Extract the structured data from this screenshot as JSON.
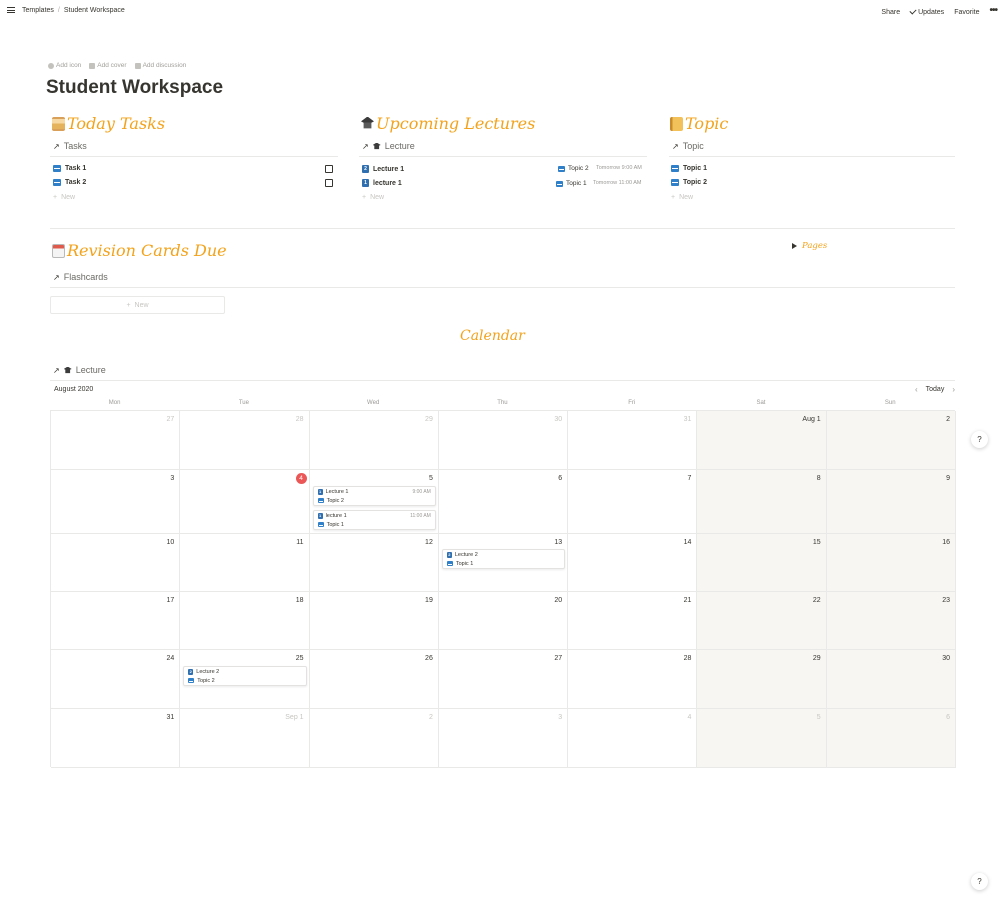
{
  "topbar": {
    "breadcrumbs": [
      "Templates",
      "Student Workspace"
    ],
    "separator": "/",
    "share": "Share",
    "updates": "Updates",
    "favorite": "Favorite",
    "more": "•••"
  },
  "page_actions": {
    "add_icon": "Add icon",
    "add_cover": "Add cover",
    "add_discussion": "Add discussion"
  },
  "page_title": "Student Workspace",
  "today_tasks": {
    "heading": "Today Tasks",
    "db_name": "Tasks",
    "items": [
      {
        "title": "Task 1",
        "done": false
      },
      {
        "title": "Task 2",
        "done": false
      }
    ],
    "new": "New"
  },
  "upcoming_lectures": {
    "heading": "Upcoming Lectures",
    "db_name": "Lecture",
    "items": [
      {
        "title": "Lecture 1",
        "topic": "Topic 2",
        "when": "Tomorrow 9:00 AM"
      },
      {
        "title": "lecture 1",
        "topic": "Topic 1",
        "when": "Tomorrow 11:00 AM"
      }
    ],
    "new": "New"
  },
  "topic": {
    "heading": "Topic",
    "db_name": "Topic",
    "items": [
      {
        "title": "Topic 1"
      },
      {
        "title": "Topic 2"
      }
    ],
    "new": "New"
  },
  "revision": {
    "heading": "Revision Cards Due",
    "db_name": "Flashcards",
    "new": "New"
  },
  "pages_toggle": "Pages",
  "calendar": {
    "heading": "Calendar",
    "db_name": "Lecture",
    "month": "August 2020",
    "today_button": "Today",
    "prev": "‹",
    "next": "›",
    "weekdays": [
      "Mon",
      "Tue",
      "Wed",
      "Thu",
      "Fri",
      "Sat",
      "Sun"
    ],
    "weeks": [
      [
        "27",
        "28",
        "29",
        "30",
        "31",
        "Aug 1",
        "2"
      ],
      [
        "3",
        "4",
        "5",
        "6",
        "7",
        "8",
        "9"
      ],
      [
        "10",
        "11",
        "12",
        "13",
        "14",
        "15",
        "16"
      ],
      [
        "17",
        "18",
        "19",
        "20",
        "21",
        "22",
        "23"
      ],
      [
        "24",
        "25",
        "26",
        "27",
        "28",
        "29",
        "30"
      ],
      [
        "31",
        "Sep 1",
        "2",
        "3",
        "4",
        "5",
        "6"
      ]
    ],
    "outside_days": {
      "w0": [
        0,
        1,
        2,
        3,
        4
      ],
      "w5": [
        1,
        2,
        3,
        4,
        5,
        6
      ]
    },
    "today_marker": "4",
    "events": [
      {
        "title": "Lecture 1",
        "time": "9:00 AM",
        "topic": "Topic 2"
      },
      {
        "title": "lecture 1",
        "time": "11:00 AM",
        "topic": "Topic 1"
      },
      {
        "title": "Lecture 2",
        "time": "",
        "topic": "Topic 1"
      },
      {
        "title": "Lecture 2",
        "time": "",
        "topic": "Topic 2"
      }
    ]
  },
  "help": "?"
}
